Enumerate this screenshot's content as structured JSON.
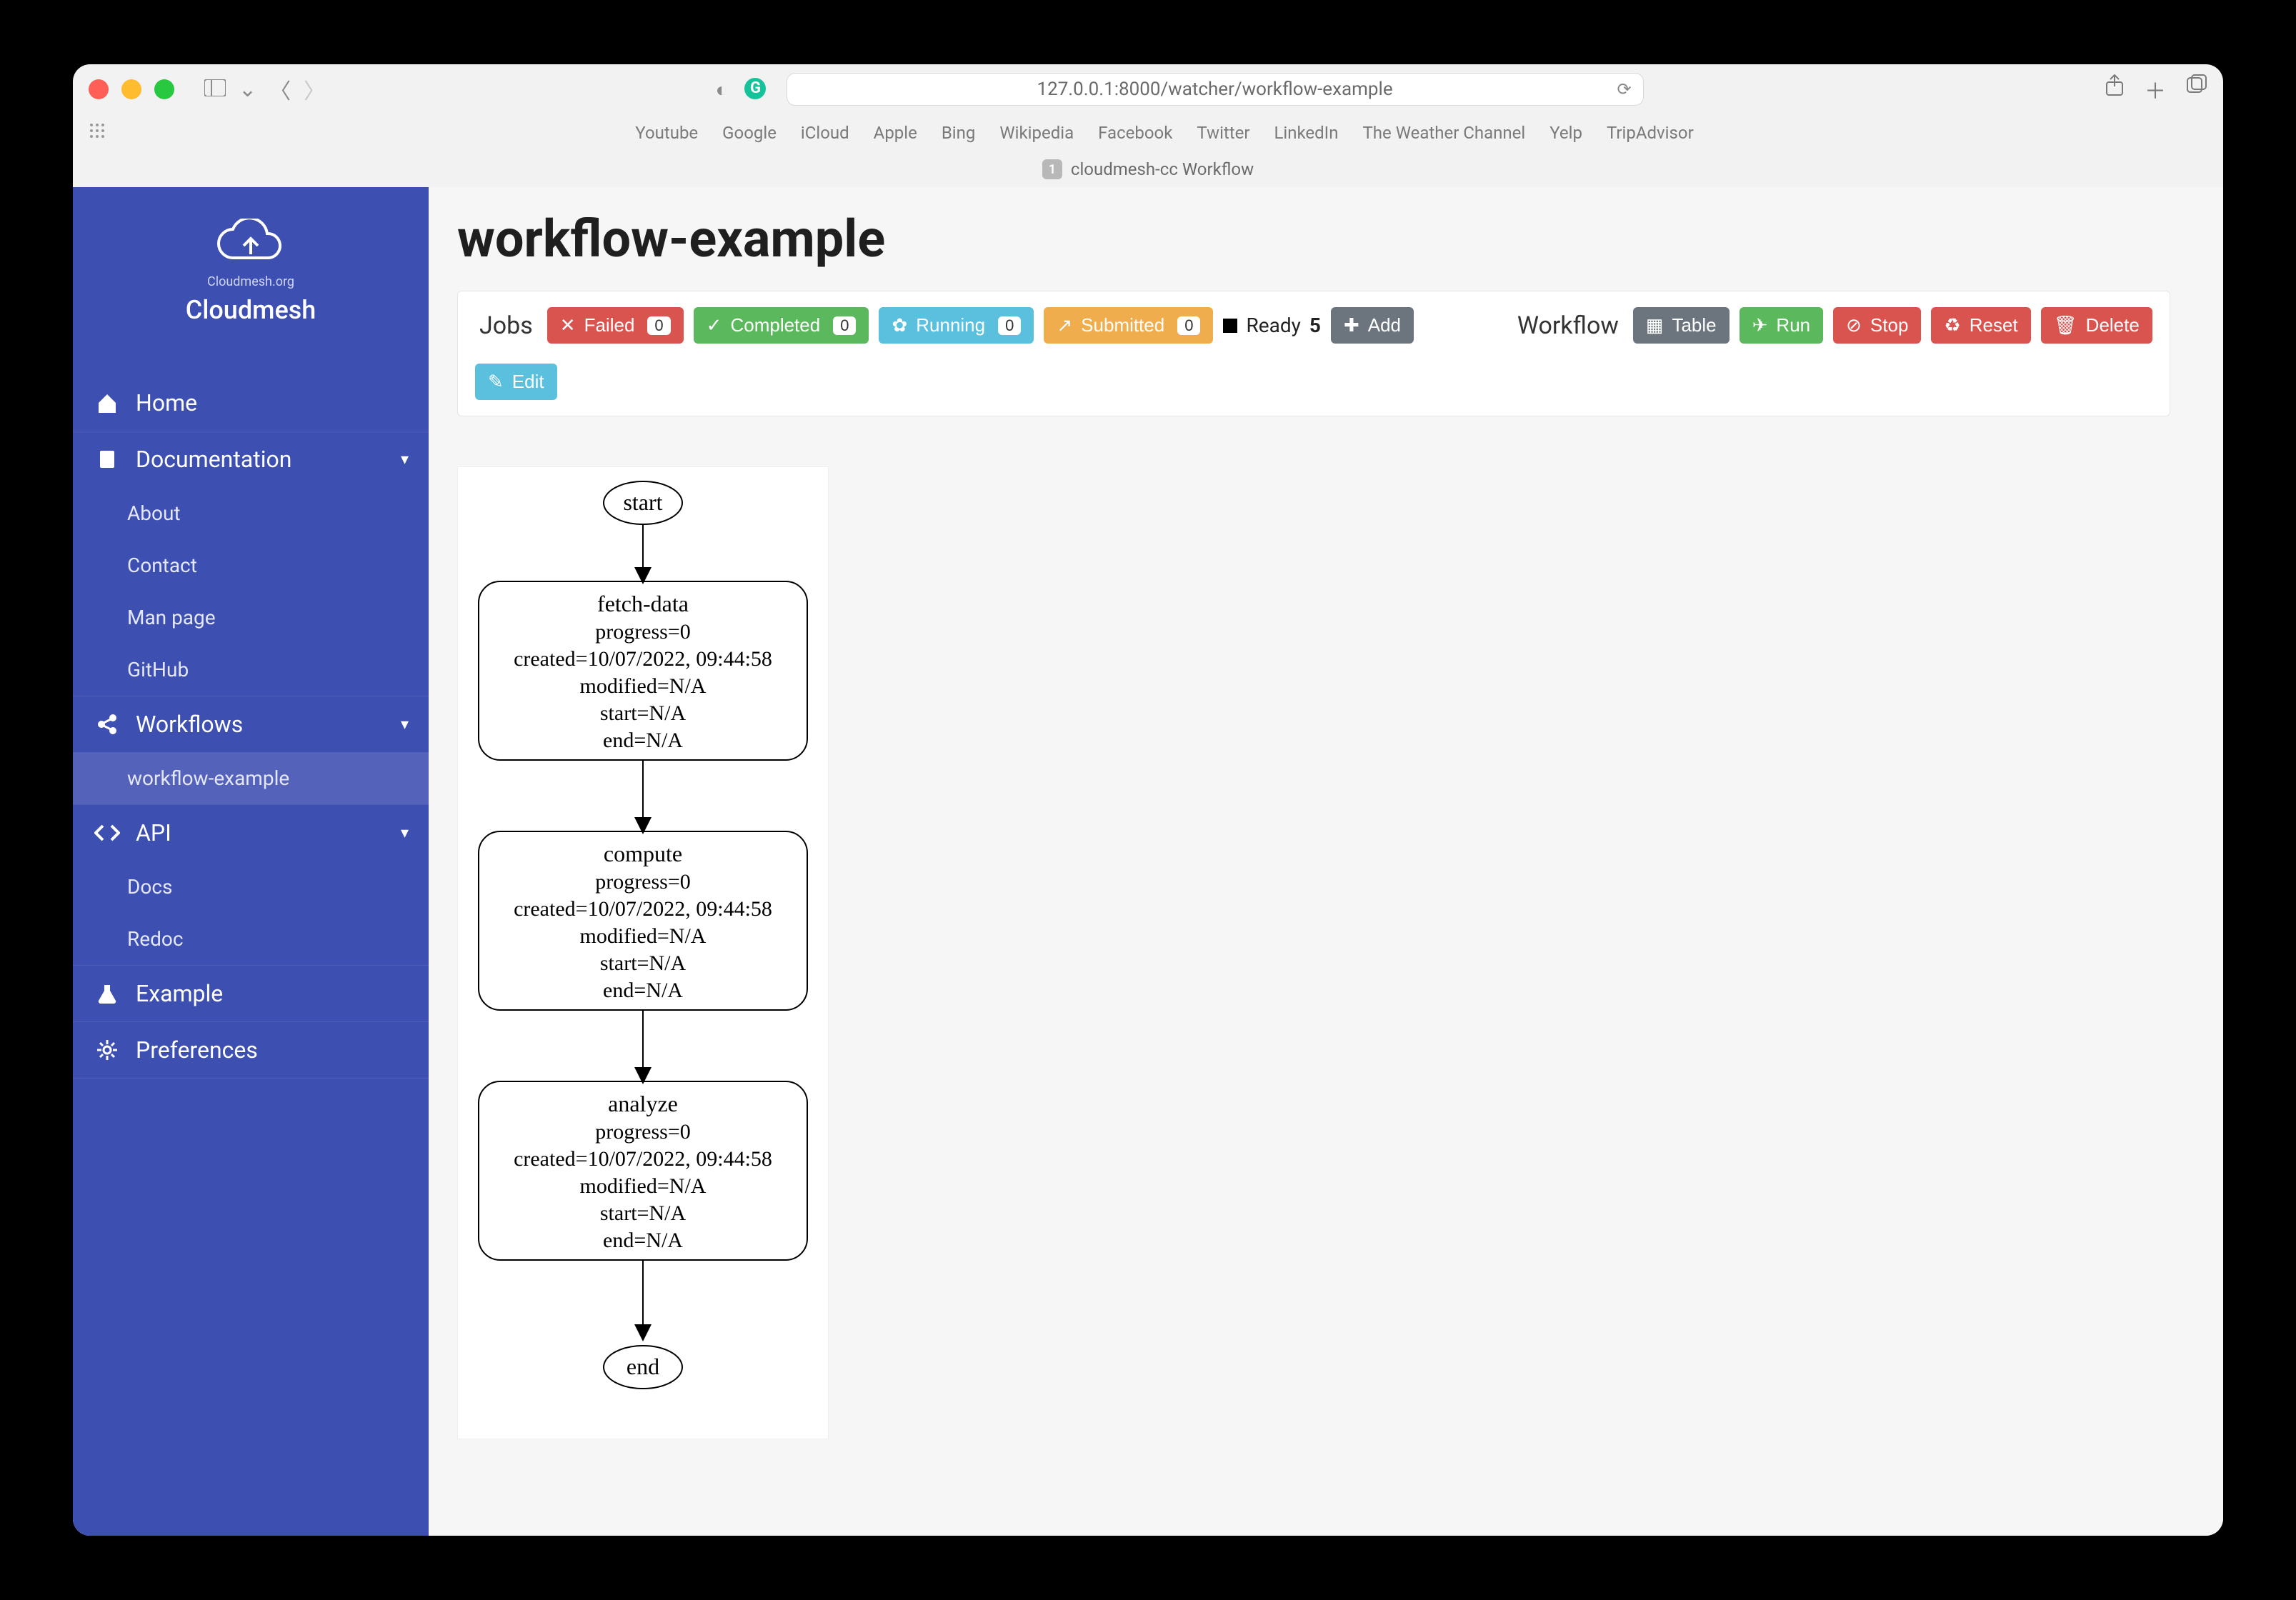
{
  "browser": {
    "url": "127.0.0.1:8000/watcher/workflow-example",
    "tab_badge": "1",
    "tab_title": "cloudmesh-cc Workflow",
    "bookmarks": [
      "Youtube",
      "Google",
      "iCloud",
      "Apple",
      "Bing",
      "Wikipedia",
      "Facebook",
      "Twitter",
      "LinkedIn",
      "The Weather Channel",
      "Yelp",
      "TripAdvisor"
    ]
  },
  "sidebar": {
    "brand_sub": "Cloudmesh.org",
    "brand_name": "Cloudmesh",
    "home": "Home",
    "documentation": {
      "label": "Documentation",
      "items": [
        "About",
        "Contact",
        "Man page",
        "GitHub"
      ]
    },
    "workflows": {
      "label": "Workflows",
      "items": [
        "workflow-example"
      ]
    },
    "api": {
      "label": "API",
      "items": [
        "Docs",
        "Redoc"
      ]
    },
    "example": "Example",
    "preferences": "Preferences"
  },
  "page": {
    "title": "workflow-example"
  },
  "jobs": {
    "label": "Jobs",
    "failed": {
      "label": "Failed",
      "count": "0"
    },
    "completed": {
      "label": "Completed",
      "count": "0"
    },
    "running": {
      "label": "Running",
      "count": "0"
    },
    "submitted": {
      "label": "Submitted",
      "count": "0"
    },
    "ready": {
      "label": "Ready",
      "count": "5"
    },
    "add": "Add",
    "edit": "Edit"
  },
  "workflow": {
    "label": "Workflow",
    "table": "Table",
    "run": "Run",
    "stop": "Stop",
    "reset": "Reset",
    "delete": "Delete"
  },
  "flow": {
    "start": "start",
    "end": "end",
    "nodes": [
      {
        "name": "fetch-data",
        "progress": "progress=0",
        "created": "created=10/07/2022, 09:44:58",
        "modified": "modified=N/A",
        "start": "start=N/A",
        "end": "end=N/A"
      },
      {
        "name": "compute",
        "progress": "progress=0",
        "created": "created=10/07/2022, 09:44:58",
        "modified": "modified=N/A",
        "start": "start=N/A",
        "end": "end=N/A"
      },
      {
        "name": "analyze",
        "progress": "progress=0",
        "created": "created=10/07/2022, 09:44:58",
        "modified": "modified=N/A",
        "start": "start=N/A",
        "end": "end=N/A"
      }
    ]
  }
}
